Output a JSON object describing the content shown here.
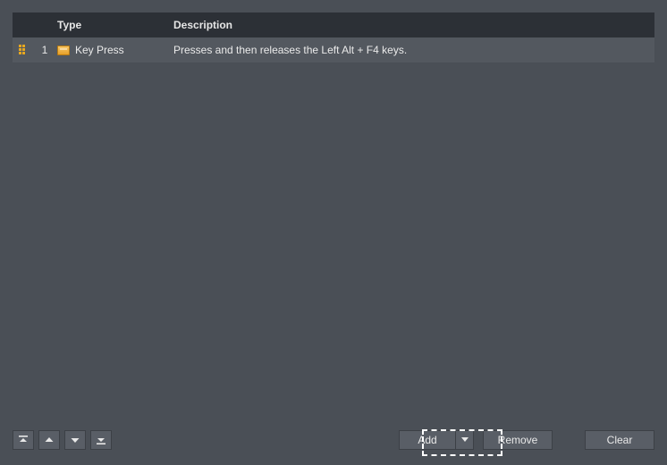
{
  "table": {
    "headers": {
      "type": "Type",
      "description": "Description"
    },
    "rows": [
      {
        "index": "1",
        "type": "Key Press",
        "description": "Presses and then releases the Left Alt + F4 keys."
      }
    ]
  },
  "buttons": {
    "add": "Add",
    "remove": "Remove",
    "clear": "Clear"
  }
}
